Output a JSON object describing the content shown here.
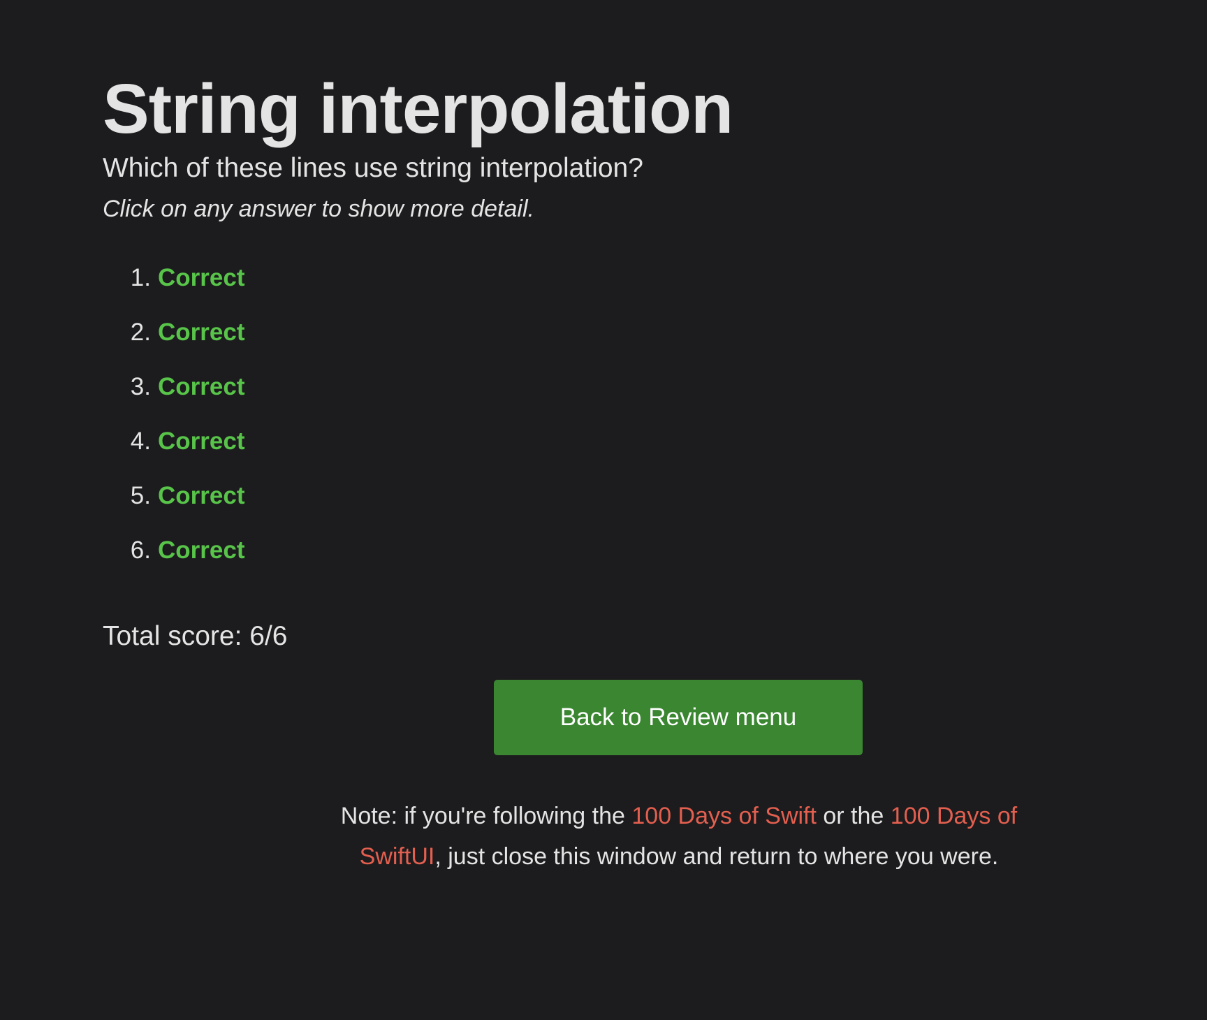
{
  "page": {
    "title": "String interpolation",
    "question": "Which of these lines use string interpolation?",
    "hint": "Click on any answer to show more detail."
  },
  "answers": [
    {
      "number": "1.",
      "verdict": "Correct"
    },
    {
      "number": "2.",
      "verdict": "Correct"
    },
    {
      "number": "3.",
      "verdict": "Correct"
    },
    {
      "number": "4.",
      "verdict": "Correct"
    },
    {
      "number": "5.",
      "verdict": "Correct"
    },
    {
      "number": "6.",
      "verdict": "Correct"
    }
  ],
  "score": {
    "label": "Total score: 6/6"
  },
  "actions": {
    "back_label": "Back to Review menu"
  },
  "note": {
    "part1": "Note: if you're following the ",
    "link1": "100 Days of Swift",
    "part2": " or the ",
    "link2": "100 Days of SwiftUI",
    "part3": ", just close this window and return to where you were."
  },
  "colors": {
    "background": "#1c1c1e",
    "correct": "#58c449",
    "button": "#3a8631",
    "link": "#e35f4f"
  }
}
